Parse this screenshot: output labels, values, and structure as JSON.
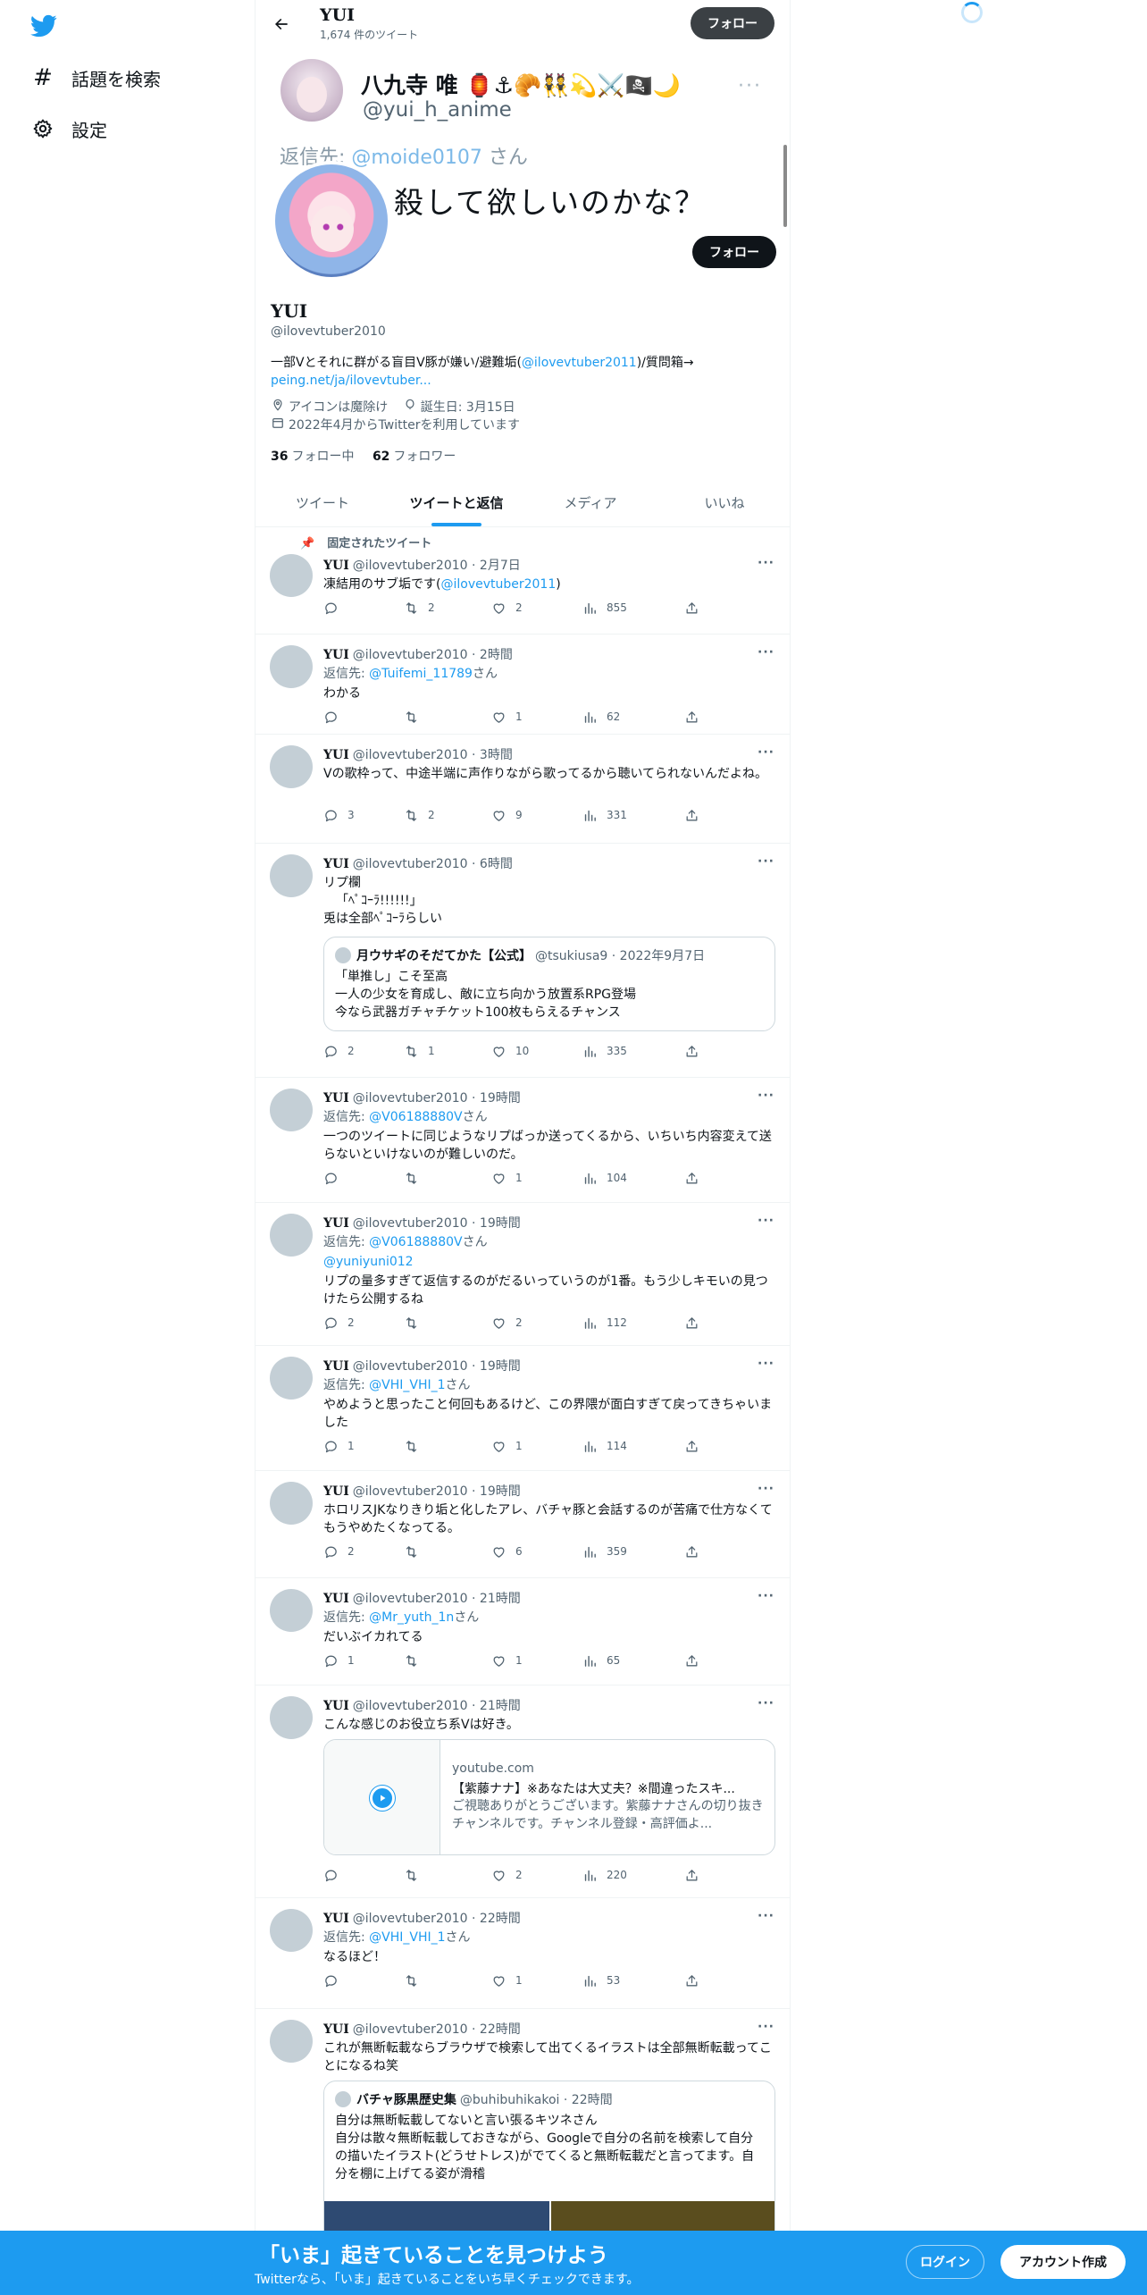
{
  "nav": {
    "logo": "twitter-bird-icon",
    "explore_label": "話題を検索",
    "settings_label": "設定"
  },
  "topbar": {
    "name": "YUI",
    "tweet_count": "1,674 件のツイート",
    "follow_label": "フォロー"
  },
  "banner": {
    "name": "八九寺 唯 🏮⚓🥐👯💫⚔️🏴‍☠️🌙",
    "handle": "@yui_h_anime",
    "more": "···",
    "reply_prefix": "返信先: ",
    "reply_handle": "@moide0107",
    "reply_suffix": " さん",
    "text": "殺して欲しいのかな？"
  },
  "profile": {
    "follow_label": "フォロー",
    "name": "YUI",
    "handle": "@ilovevtuber2010",
    "bio_text": "一部Vとそれに群がる盲目V豚が嫌い/避難垢(",
    "bio_link": "@ilovevtuber2011",
    "bio_text2": ")/質問箱→",
    "bio_url": "peing.net/ja/ilovevtuber...",
    "location": "アイコンは魔除け",
    "birthday": "誕生日: 3月15日",
    "joined": "2022年4月からTwitterを利用しています",
    "following_count": "36",
    "following_label": "フォロー中",
    "followers_count": "62",
    "followers_label": "フォロワー"
  },
  "tabs": [
    "ツイート",
    "ツイートと返信",
    "メディア",
    "いいね"
  ],
  "pinned_label": "固定されたツイート",
  "tweets": [
    {
      "name": "YUI",
      "handle": "@ilovevtuber2010",
      "time": "2月7日",
      "text1": "凍結用のサブ垢です(",
      "link": "@ilovevtuber2011",
      "text2": ")",
      "reply": "",
      "retweet": "2",
      "like": "2",
      "views": "855"
    },
    {
      "name": "YUI",
      "handle": "@ilovevtuber2010",
      "time": "2時間",
      "reply_prefix": "返信先: ",
      "reply_to": "@Tuifemi_11789",
      "reply_suffix": "さん",
      "text": "わかる",
      "reply": "",
      "retweet": "",
      "like": "1",
      "views": "62"
    },
    {
      "name": "YUI",
      "handle": "@ilovevtuber2010",
      "time": "3時間",
      "text": "Vの歌枠って、中途半端に声作りながら歌ってるから聴いてられないんだよね。",
      "reply": "3",
      "retweet": "2",
      "like": "9",
      "views": "331"
    },
    {
      "name": "YUI",
      "handle": "@ilovevtuber2010",
      "time": "6時間",
      "line1": "リプ欄",
      "line2": "「ﾍﾟｺｰﾗ!!!!!!」",
      "line3": "兎は全部ﾍﾟｺｰﾗらしい",
      "quote_name": "月ウサギのそだてかた【公式】",
      "quote_handle": "@tsukiusa9",
      "quote_time": "2022年9月7日",
      "quote_l1": "「単推し」こそ至高",
      "quote_l2": "一人の少女を育成し、敵に立ち向かう放置系RPG登場",
      "quote_l3": "今なら武器ガチャチケット100枚もらえるチャンス",
      "reply": "2",
      "retweet": "1",
      "like": "10",
      "views": "335"
    },
    {
      "name": "YUI",
      "handle": "@ilovevtuber2010",
      "time": "19時間",
      "reply_prefix": "返信先: ",
      "reply_to": "@V06188880V",
      "reply_suffix": "さん",
      "text": "一つのツイートに同じようなリプばっか送ってくるから、いちいち内容変えて送らないといけないのが難しいのだ。",
      "reply": "",
      "retweet": "",
      "like": "1",
      "views": "104"
    },
    {
      "name": "YUI",
      "handle": "@ilovevtuber2010",
      "time": "19時間",
      "reply_prefix": "返信先: ",
      "reply_to": "@V06188880V",
      "reply_suffix": "さん",
      "mention": "@yuniyuni012",
      "text": "リプの量多すぎて返信するのがだるいっていうのが1番。もう少しキモいの見つけたら公開するね",
      "reply": "2",
      "retweet": "",
      "like": "2",
      "views": "112"
    },
    {
      "name": "YUI",
      "handle": "@ilovevtuber2010",
      "time": "19時間",
      "reply_prefix": "返信先: ",
      "reply_to": "@VHI_VHI_1",
      "reply_suffix": "さん",
      "text": "やめようと思ったこと何回もあるけど、この界隈が面白すぎて戻ってきちゃいました",
      "reply": "1",
      "retweet": "",
      "like": "1",
      "views": "114"
    },
    {
      "name": "YUI",
      "handle": "@ilovevtuber2010",
      "time": "19時間",
      "text": "ホロリスJKなりきり垢と化したアレ、バチャ豚と会話するのが苦痛で仕方なくてもうやめたくなってる。",
      "reply": "2",
      "retweet": "",
      "like": "6",
      "views": "359"
    },
    {
      "name": "YUI",
      "handle": "@ilovevtuber2010",
      "time": "21時間",
      "reply_prefix": "返信先: ",
      "reply_to": "@Mr_yuth_1n",
      "reply_suffix": "さん",
      "text": "だいぶイカれてる",
      "reply": "1",
      "retweet": "",
      "like": "1",
      "views": "65"
    },
    {
      "name": "YUI",
      "handle": "@ilovevtuber2010",
      "time": "21時間",
      "text": "こんな感じのお役立ち系Vは好き。",
      "card_domain": "youtube.com",
      "card_title": "【紫藤ナナ】※あなたは大丈夫？※間違ったスキ...",
      "card_desc": "ご視聴ありがとうございます。紫藤ナナさんの切り抜きチャンネルです。チャンネル登録・高評価よ...",
      "reply": "",
      "retweet": "",
      "like": "2",
      "views": "220"
    },
    {
      "name": "YUI",
      "handle": "@ilovevtuber2010",
      "time": "22時間",
      "reply_prefix": "返信先: ",
      "reply_to": "@VHI_VHI_1",
      "reply_suffix": "さん",
      "text": "なるほど！",
      "reply": "",
      "retweet": "",
      "like": "1",
      "views": "53"
    },
    {
      "name": "YUI",
      "handle": "@ilovevtuber2010",
      "time": "22時間",
      "text": "これが無断転載ならブラウザで検索して出てくるイラストは全部無断転載ってことになるね笑",
      "quote_name": "バチャ豚黒歴史集",
      "quote_handle": "@buhibuhikakoi",
      "quote_time": "22時間",
      "quote_l1": "自分は無断転載してないと言い張るキツネさん",
      "quote_l2": "自分は散々無断転載しておきながら、Googleで自分の名前を検索して自分の描いたイラスト(どうせトレス)がでてくると無断転載だと言ってます。自分を棚に上げてる姿が滑稽"
    }
  ],
  "footer": {
    "title": "「いま」起きていることを見つけよう",
    "subtitle": "Twitterなら、「いま」起きていることをいち早くチェックできます。",
    "login_label": "ログイン",
    "signup_label": "アカウント作成"
  },
  "colors": {
    "accent": "#1d9bf0",
    "text": "#0f1419",
    "muted": "#536471"
  }
}
